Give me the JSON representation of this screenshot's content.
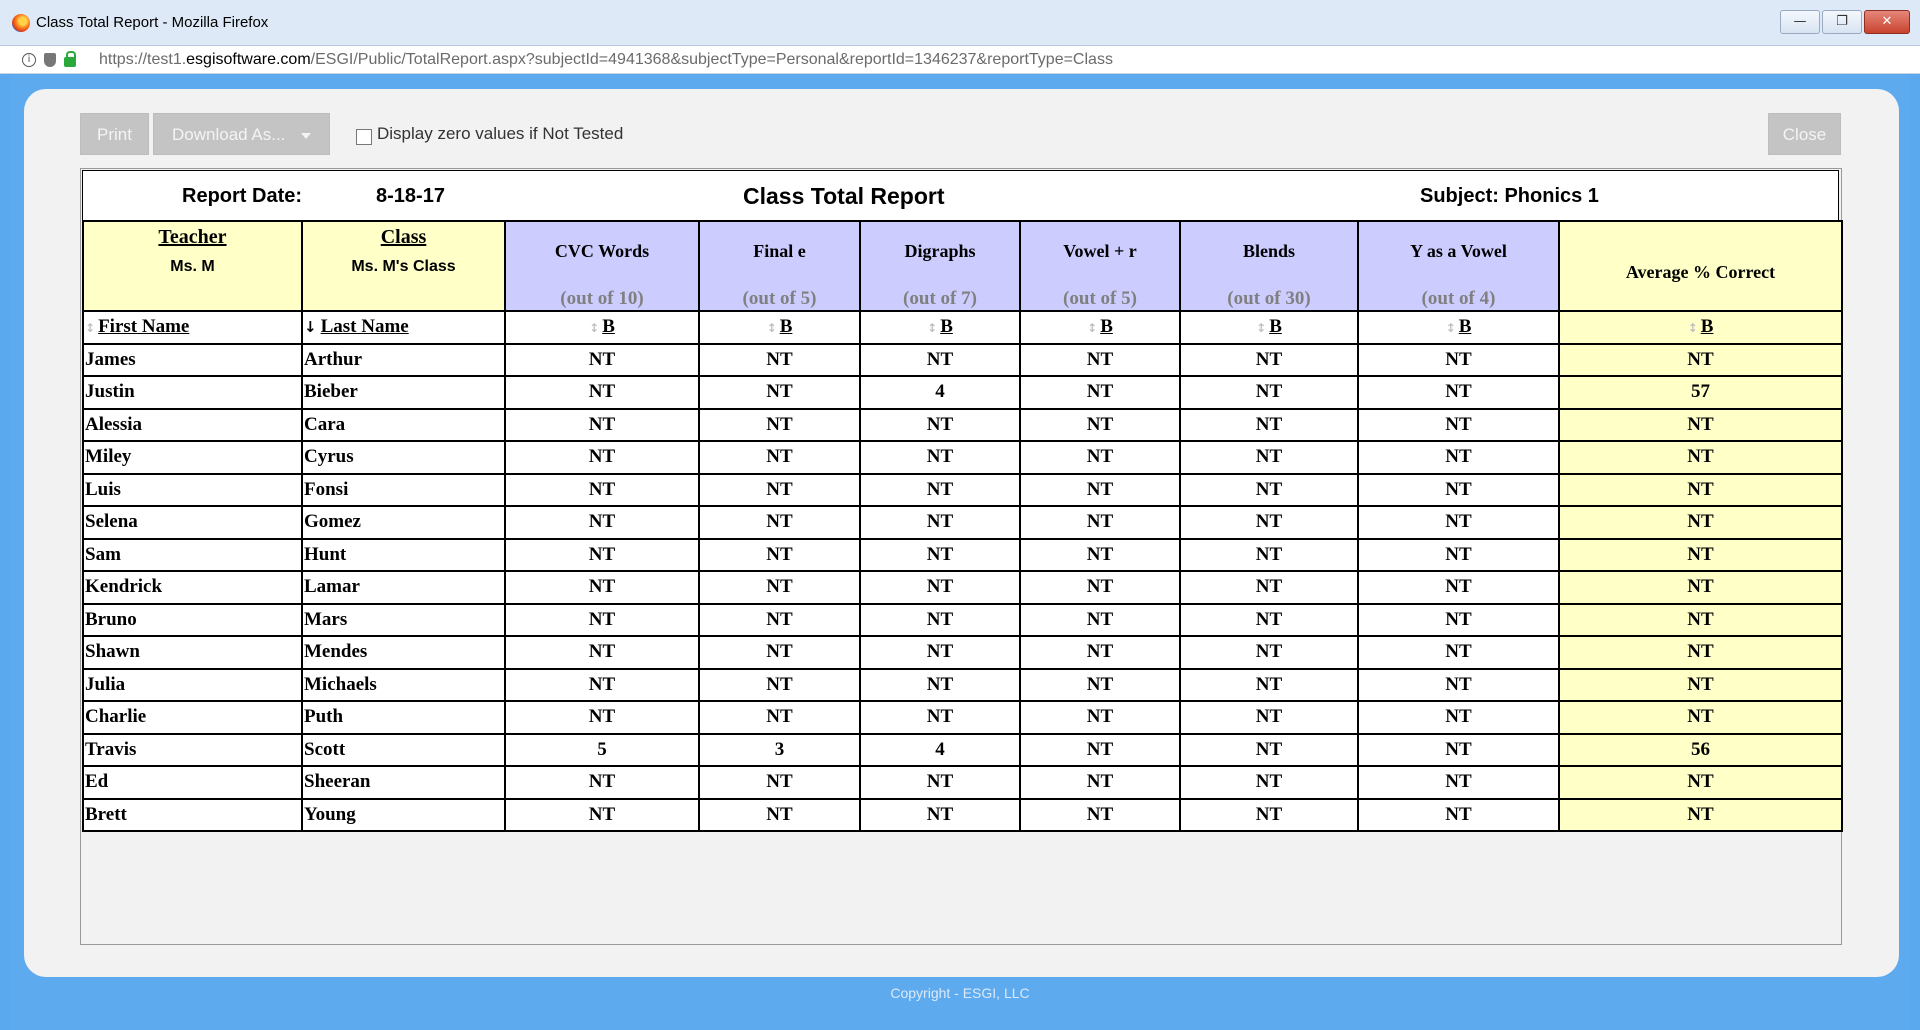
{
  "window": {
    "title": "Class Total Report - Mozilla Firefox",
    "minimize": "—",
    "maximize": "❐",
    "close": "✕"
  },
  "urlbar": {
    "prefix": "https://test1.",
    "domain": "esgisoftware.com",
    "path": "/ESGI/Public/TotalReport.aspx?subjectId=4941368&subjectType=Personal&reportId=1346237&reportType=Class",
    "info": "i"
  },
  "toolbar": {
    "print_label": "Print",
    "download_label": "Download As...",
    "zero_values_label": "Display zero values if Not Tested",
    "close_label": "Close"
  },
  "report": {
    "date_label": "Report Date:",
    "date_value": "8-18-17",
    "title": "Class Total Report",
    "subject": "Subject: Phonics 1",
    "teacher_label": "Teacher",
    "teacher_name": "Ms. M",
    "class_label": "Class",
    "class_name": "Ms. M's Class",
    "average_label": "Average % Correct",
    "first_name_label": "First Name",
    "last_name_label": "Last Name",
    "sort_label": "B",
    "sort_arrow_inactive": "↕",
    "sort_arrow_active": "↓",
    "columns": [
      {
        "name": "CVC Words",
        "out_of": "(out of 10)"
      },
      {
        "name": "Final e",
        "out_of": "(out of 5)"
      },
      {
        "name": "Digraphs",
        "out_of": "(out of 7)"
      },
      {
        "name": "Vowel + r",
        "out_of": "(out of 5)"
      },
      {
        "name": "Blends",
        "out_of": "(out of 30)"
      },
      {
        "name": "Y as a Vowel",
        "out_of": "(out of 4)"
      }
    ],
    "rows": [
      {
        "first": "James",
        "last": "Arthur",
        "scores": [
          "NT",
          "NT",
          "NT",
          "NT",
          "NT",
          "NT"
        ],
        "avg": "NT"
      },
      {
        "first": "Justin",
        "last": "Bieber",
        "scores": [
          "NT",
          "NT",
          "4",
          "NT",
          "NT",
          "NT"
        ],
        "avg": "57"
      },
      {
        "first": "Alessia",
        "last": "Cara",
        "scores": [
          "NT",
          "NT",
          "NT",
          "NT",
          "NT",
          "NT"
        ],
        "avg": "NT"
      },
      {
        "first": "Miley",
        "last": "Cyrus",
        "scores": [
          "NT",
          "NT",
          "NT",
          "NT",
          "NT",
          "NT"
        ],
        "avg": "NT"
      },
      {
        "first": "Luis",
        "last": "Fonsi",
        "scores": [
          "NT",
          "NT",
          "NT",
          "NT",
          "NT",
          "NT"
        ],
        "avg": "NT"
      },
      {
        "first": "Selena",
        "last": "Gomez",
        "scores": [
          "NT",
          "NT",
          "NT",
          "NT",
          "NT",
          "NT"
        ],
        "avg": "NT"
      },
      {
        "first": "Sam",
        "last": "Hunt",
        "scores": [
          "NT",
          "NT",
          "NT",
          "NT",
          "NT",
          "NT"
        ],
        "avg": "NT"
      },
      {
        "first": "Kendrick",
        "last": "Lamar",
        "scores": [
          "NT",
          "NT",
          "NT",
          "NT",
          "NT",
          "NT"
        ],
        "avg": "NT"
      },
      {
        "first": "Bruno",
        "last": "Mars",
        "scores": [
          "NT",
          "NT",
          "NT",
          "NT",
          "NT",
          "NT"
        ],
        "avg": "NT"
      },
      {
        "first": "Shawn",
        "last": "Mendes",
        "scores": [
          "NT",
          "NT",
          "NT",
          "NT",
          "NT",
          "NT"
        ],
        "avg": "NT"
      },
      {
        "first": "Julia",
        "last": "Michaels",
        "scores": [
          "NT",
          "NT",
          "NT",
          "NT",
          "NT",
          "NT"
        ],
        "avg": "NT"
      },
      {
        "first": "Charlie",
        "last": "Puth",
        "scores": [
          "NT",
          "NT",
          "NT",
          "NT",
          "NT",
          "NT"
        ],
        "avg": "NT"
      },
      {
        "first": "Travis",
        "last": "Scott",
        "scores": [
          "5",
          "3",
          "4",
          "NT",
          "NT",
          "NT"
        ],
        "avg": "56"
      },
      {
        "first": "Ed",
        "last": "Sheeran",
        "scores": [
          "NT",
          "NT",
          "NT",
          "NT",
          "NT",
          "NT"
        ],
        "avg": "NT"
      },
      {
        "first": "Brett",
        "last": "Young",
        "scores": [
          "NT",
          "NT",
          "NT",
          "NT",
          "NT",
          "NT"
        ],
        "avg": "NT"
      }
    ]
  },
  "footer": {
    "copyright": "Copyright - ESGI, LLC"
  },
  "colors": {
    "frame_blue": "#5eaaee",
    "header_yellow": "#ffffc8",
    "header_lavender": "#ccccff",
    "button_gray": "#c4c4c4"
  }
}
